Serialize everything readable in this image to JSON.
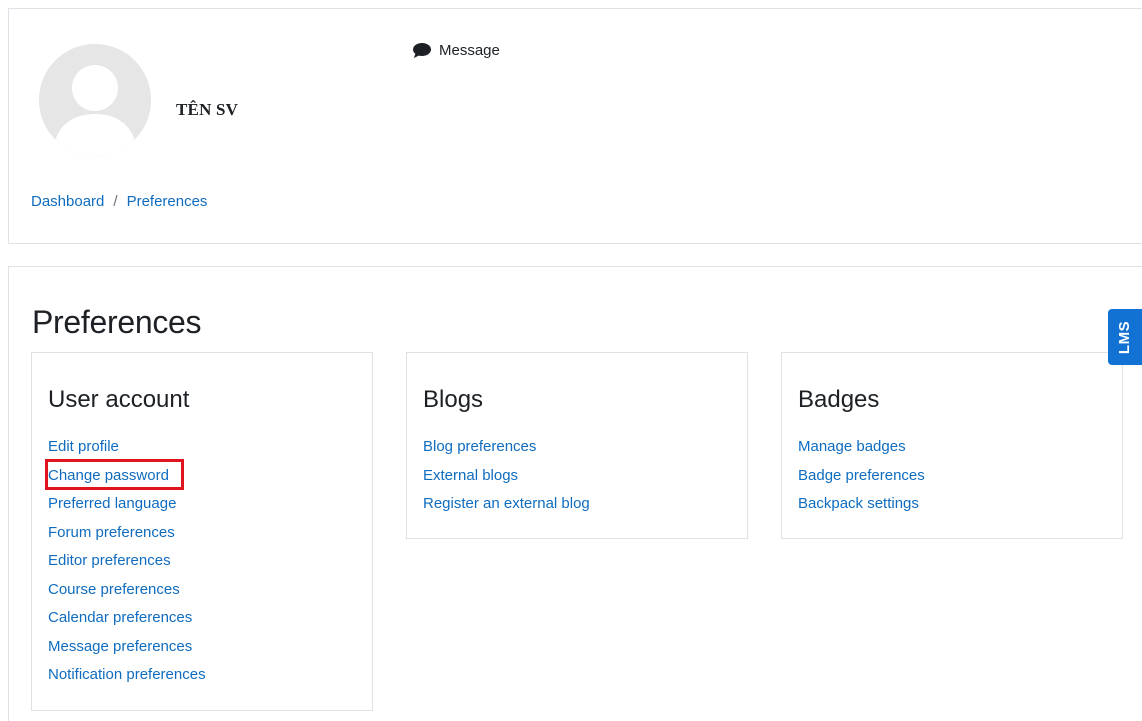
{
  "header": {
    "user_name": "TÊN SV",
    "message_label": "Message",
    "avatar_icon": "default-user-avatar-icon",
    "message_icon": "speech-bubble-icon"
  },
  "breadcrumb": {
    "items": [
      "Dashboard",
      "Preferences"
    ],
    "separator": "/"
  },
  "main": {
    "title": "Preferences",
    "sections": [
      {
        "title": "User account",
        "links": [
          "Edit profile",
          "Change password",
          "Preferred language",
          "Forum preferences",
          "Editor preferences",
          "Course preferences",
          "Calendar preferences",
          "Message preferences",
          "Notification preferences"
        ]
      },
      {
        "title": "Blogs",
        "links": [
          "Blog preferences",
          "External blogs",
          "Register an external blog"
        ]
      },
      {
        "title": "Badges",
        "links": [
          "Manage badges",
          "Badge preferences",
          "Backpack settings"
        ]
      }
    ]
  },
  "side_tab": {
    "label": "LMS"
  },
  "colors": {
    "link": "#0f6cbf",
    "highlight": "#e0141e",
    "side_tab": "#1272d4",
    "border": "#dee2e6"
  }
}
